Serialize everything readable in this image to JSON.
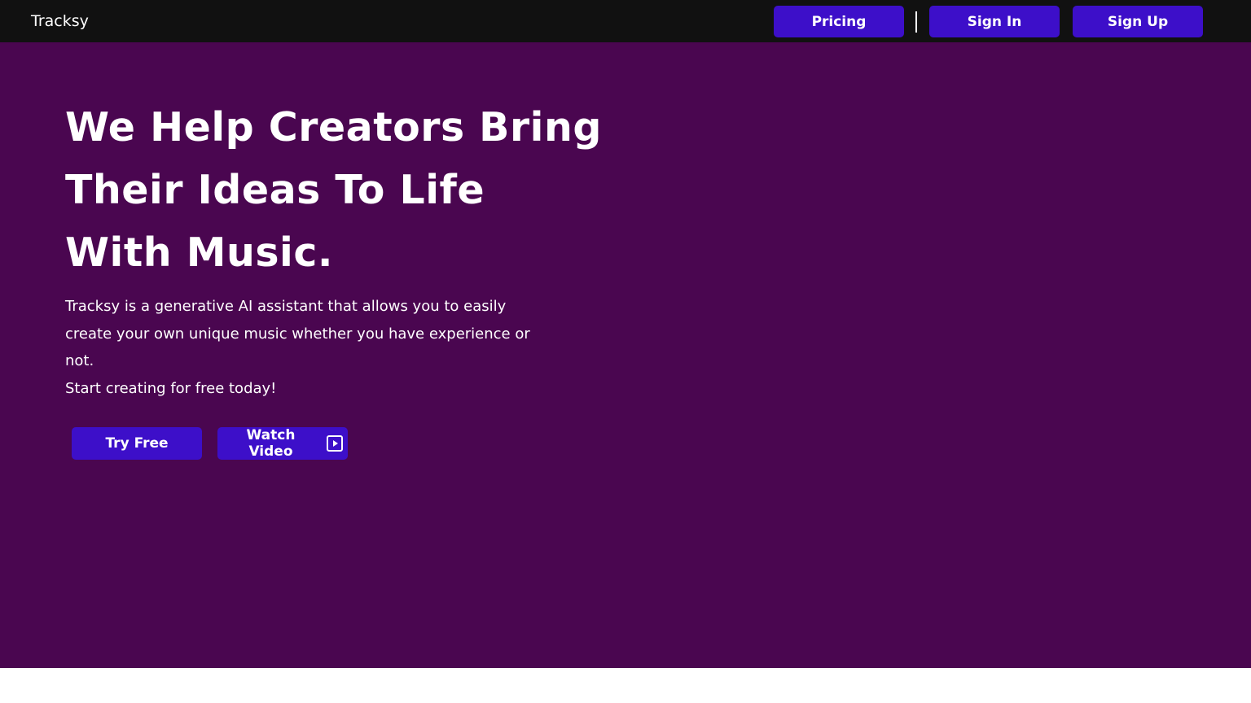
{
  "nav": {
    "brand": "Tracksy",
    "pricing_label": "Pricing",
    "signin_label": "Sign In",
    "signup_label": "Sign Up"
  },
  "hero": {
    "headline_lines": [
      "We Help Creators Bring",
      "Their Ideas To Life",
      "With Music."
    ],
    "description": "Tracksy is a generative AI assistant that allows you to easily create your own unique music whether you have experience or not.",
    "tagline": "Start creating for free today!",
    "try_free_label": "Try Free",
    "watch_video_label": "Watch Video",
    "watch_video_icon": "play-icon"
  },
  "colors": {
    "navbar_bg": "#111111",
    "hero_bg": "#4a0650",
    "button_bg": "#3d0fc9",
    "text": "#ffffff"
  }
}
